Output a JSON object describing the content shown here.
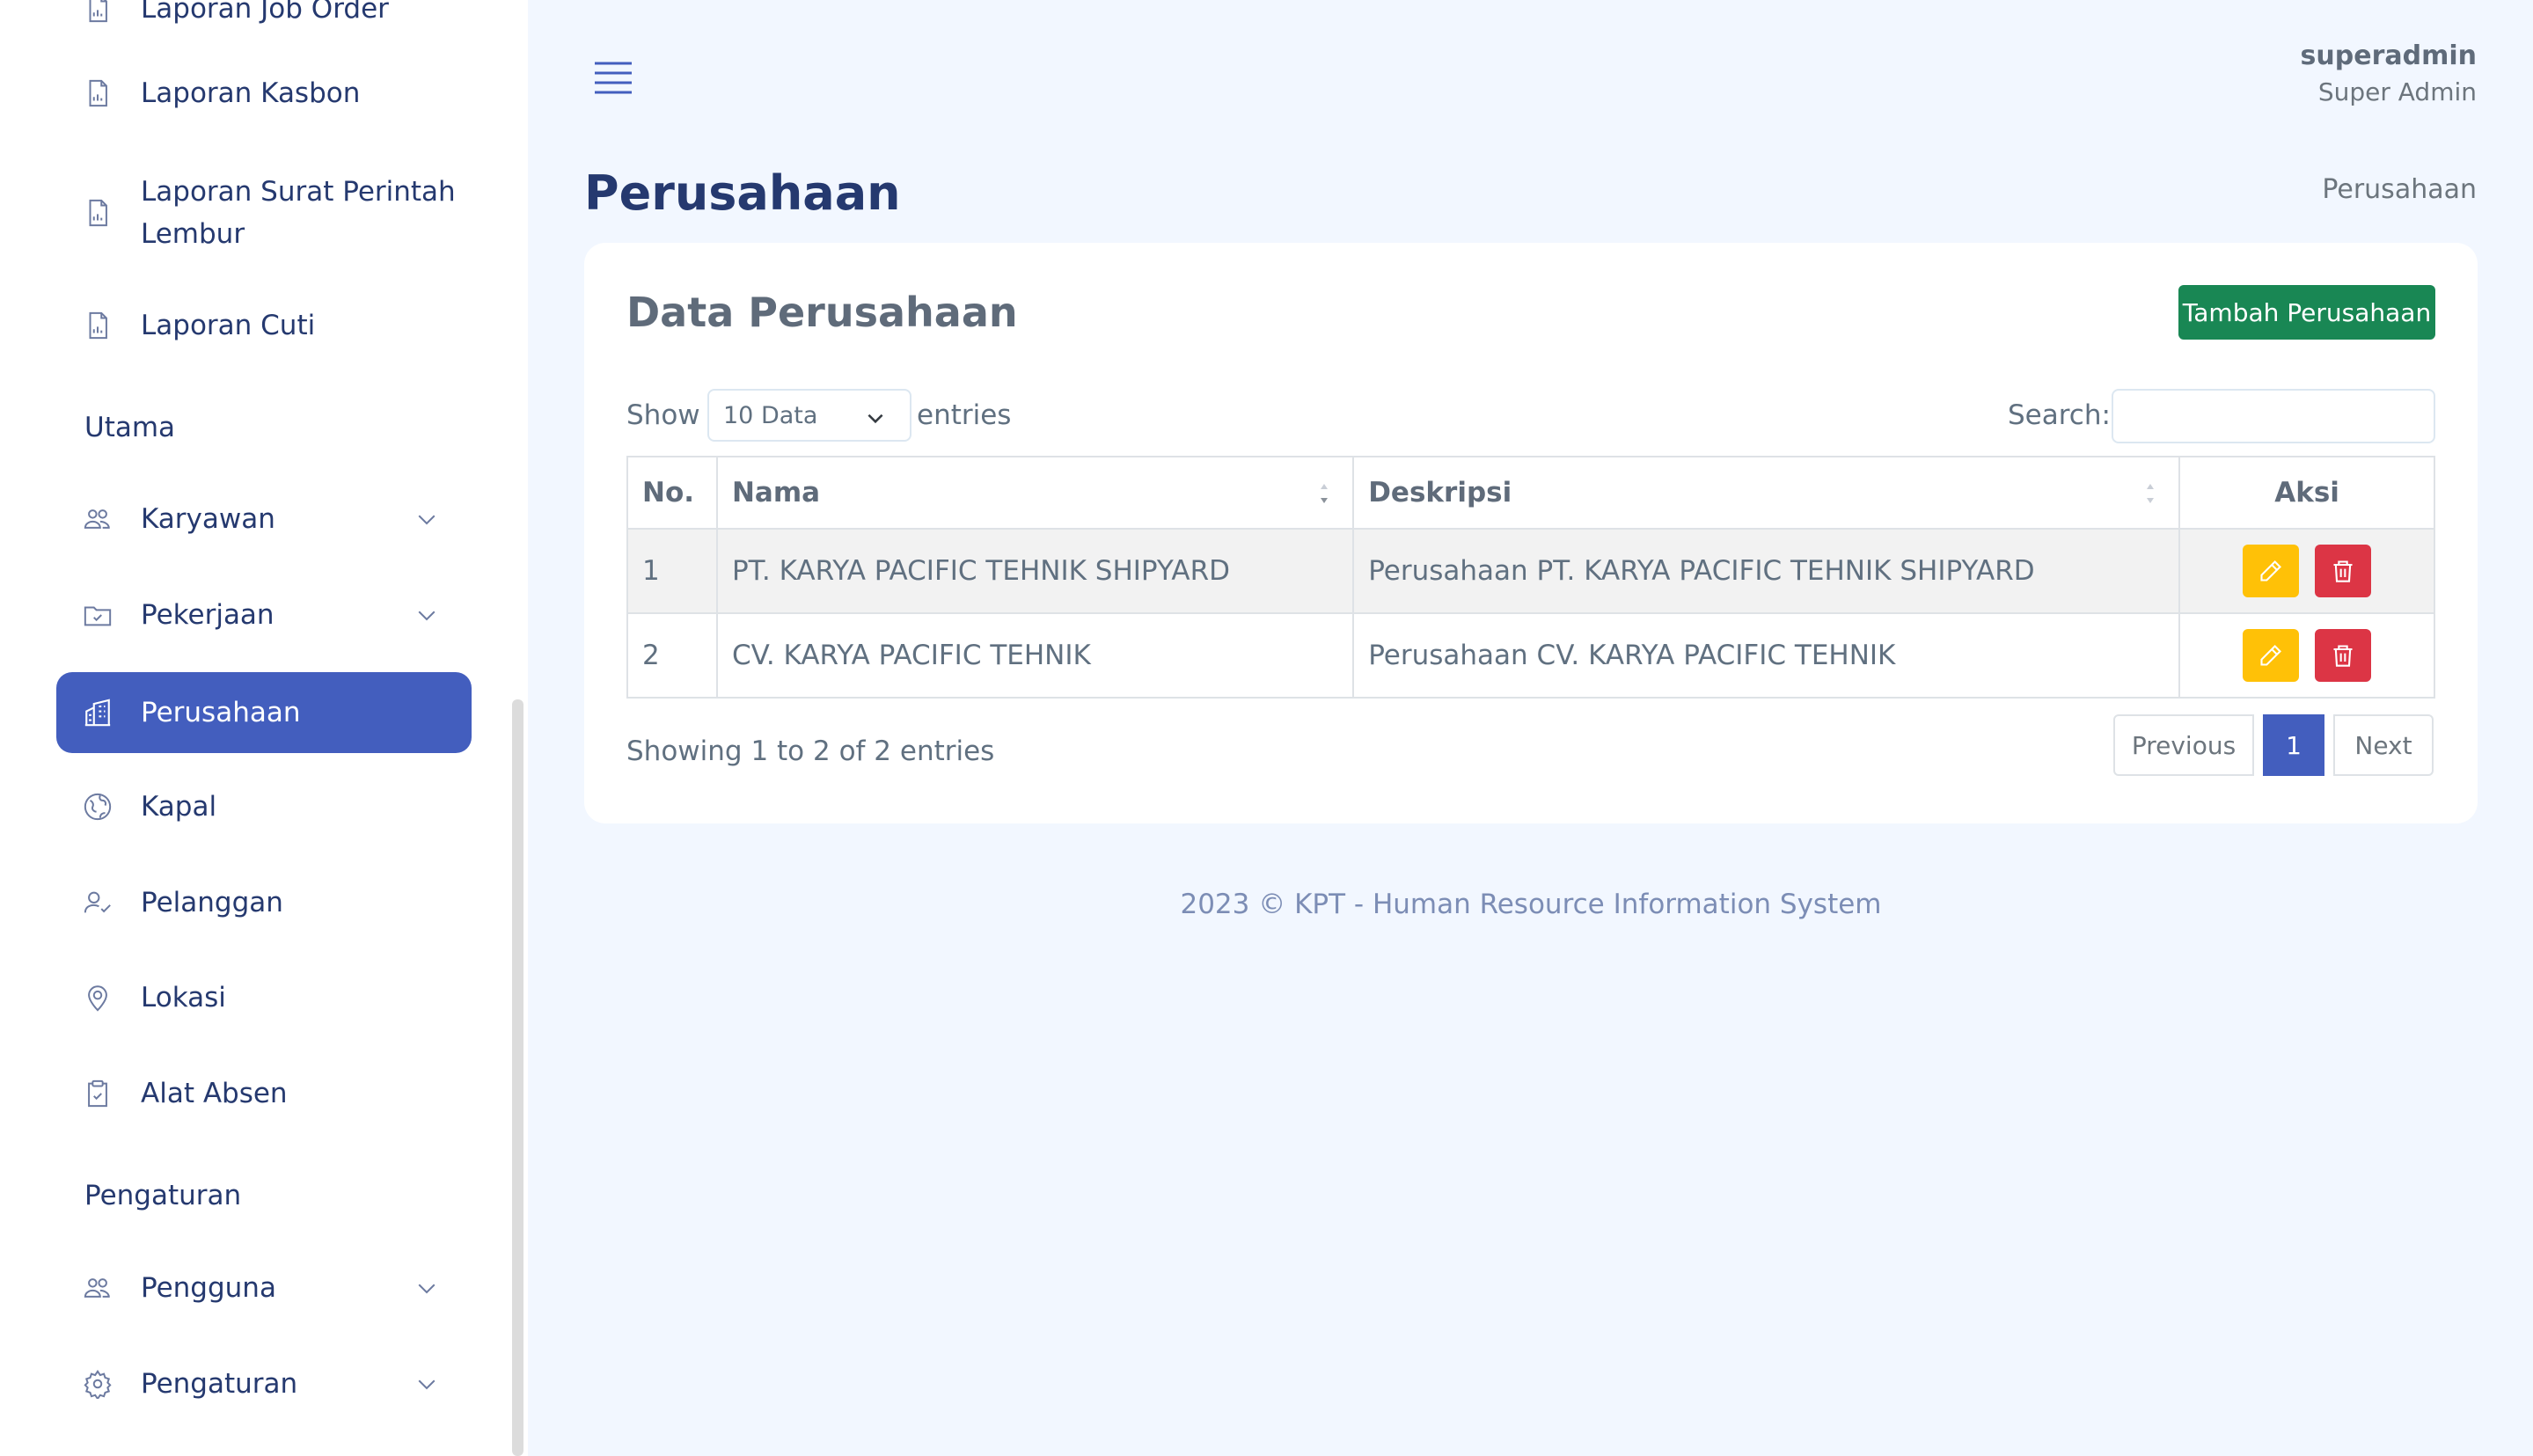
{
  "sidebar": {
    "items": [
      {
        "label": "Laporan Job Order",
        "icon": "report-icon"
      },
      {
        "label": "Laporan Kasbon",
        "icon": "report-icon"
      },
      {
        "label": "Laporan Surat Perintah Lembur",
        "icon": "report-icon"
      },
      {
        "label": "Laporan Cuti",
        "icon": "report-icon"
      }
    ],
    "section_main": "Utama",
    "main_items": [
      {
        "label": "Karyawan",
        "icon": "people-icon",
        "has_submenu": true
      },
      {
        "label": "Pekerjaan",
        "icon": "folder-icon",
        "has_submenu": true
      },
      {
        "label": "Perusahaan",
        "icon": "building-icon",
        "active": true
      },
      {
        "label": "Kapal",
        "icon": "globe-icon"
      },
      {
        "label": "Pelanggan",
        "icon": "person-check-icon"
      },
      {
        "label": "Lokasi",
        "icon": "map-pin-icon"
      },
      {
        "label": "Alat Absen",
        "icon": "clipboard-check-icon"
      }
    ],
    "section_settings": "Pengaturan",
    "settings_items": [
      {
        "label": "Pengguna",
        "icon": "people-icon",
        "has_submenu": true
      },
      {
        "label": "Pengaturan",
        "icon": "gear-icon",
        "has_submenu": true
      }
    ]
  },
  "header": {
    "user_name": "superadmin",
    "user_role": "Super Admin"
  },
  "page": {
    "title": "Perusahaan",
    "breadcrumb": "Perusahaan"
  },
  "card": {
    "title": "Data Perusahaan",
    "add_button": "Tambah Perusahaan",
    "show_label": "Show",
    "entries_selected": "10 Data",
    "entries_label": "entries",
    "search_label": "Search:",
    "search_value": "",
    "columns": [
      "No.",
      "Nama",
      "Deskripsi",
      "Aksi"
    ],
    "rows": [
      {
        "no": "1",
        "nama": "PT. KARYA PACIFIC TEHNIK SHIPYARD",
        "deskripsi": "Perusahaan PT. KARYA PACIFIC TEHNIK SHIPYARD"
      },
      {
        "no": "2",
        "nama": "CV. KARYA PACIFIC TEHNIK",
        "deskripsi": "Perusahaan CV. KARYA PACIFIC TEHNIK"
      }
    ],
    "showing_text": "Showing 1 to 2 of 2 entries",
    "pagination": {
      "previous": "Previous",
      "current": "1",
      "next": "Next"
    }
  },
  "footer": {
    "text": "2023 © KPT - Human Resource Information System"
  },
  "colors": {
    "primary": "#435ebe",
    "success": "#198754",
    "warning": "#ffc107",
    "danger": "#dc3545",
    "background": "#f2f7ff"
  }
}
